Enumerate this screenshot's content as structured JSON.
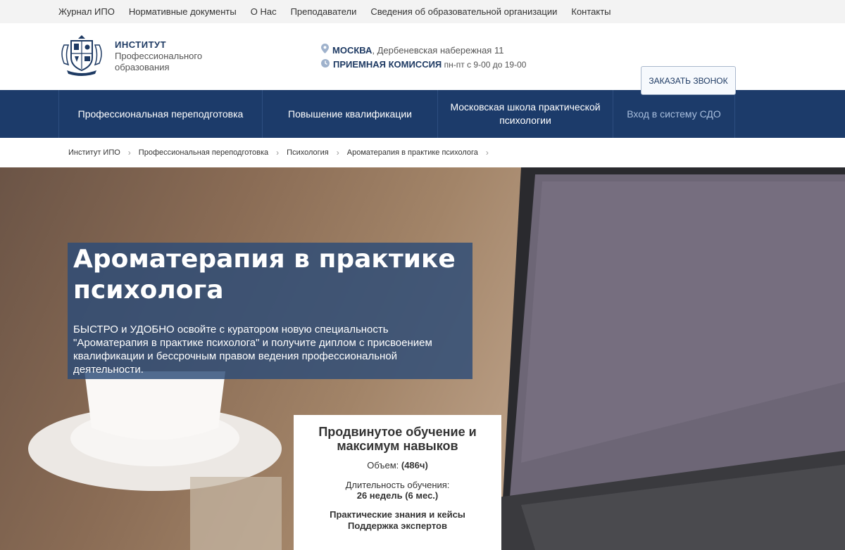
{
  "top_links": [
    "Журнал ИПО",
    "Нормативные документы",
    "О Нас",
    "Преподаватели",
    "Сведения об образовательной организации",
    "Контакты"
  ],
  "brand": {
    "line1": "ИНСТИТУТ",
    "line2": "Профессионального",
    "line3": "образования"
  },
  "contacts": {
    "city": "МОСКВА",
    "address": ", Дербеневская набережная 11",
    "admission": "ПРИЕМНАЯ КОМИССИЯ",
    "hours": " пн-пт с 9-00 до 19-00"
  },
  "call_button": "ЗАКАЗАТЬ ЗВОНОК",
  "main_nav": [
    "Профессиональная переподготовка",
    "Повышение квалификации",
    "Московская школа практической психологии",
    "Вход в систему СДО"
  ],
  "breadcrumb": [
    "Институт ИПО",
    "Профессиональная переподготовка",
    "Психология",
    "Ароматерапия в практике психолога"
  ],
  "hero": {
    "title": "Ароматерапия в практике психолога",
    "description": "БЫСТРО и УДОБНО освойте с куратором новую специальность \"Ароматерапия в практике психолога\" и получите диплом с присвоением квалификации и бессрочным правом ведения профессиональной деятельности."
  },
  "card": {
    "title": "Продвинутое обучение и максимум навыков",
    "volume_label": "Объем: ",
    "volume_value": "(486ч)",
    "duration_label": "Длительность обучения:",
    "duration_value": "26 недель (6 мес.)",
    "feature1": "Практические знания и кейсы",
    "feature2": "Поддержка экспертов"
  },
  "icons": {
    "location": "map-pin-icon",
    "clock": "clock-icon",
    "chevron": "chevron-right-icon",
    "logo": "institute-crest-logo"
  },
  "colors": {
    "nav_bg": "#1c3b6a",
    "brand_blue": "#1e3a63",
    "title_box": "#2c4c78"
  }
}
